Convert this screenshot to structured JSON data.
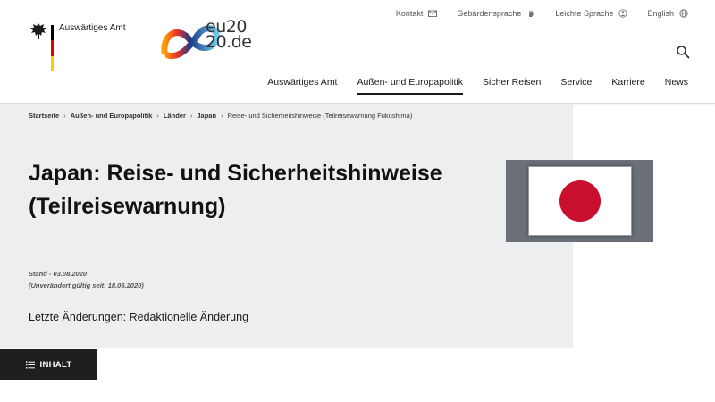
{
  "header": {
    "brand_name": "Auswärtiges Amt",
    "eu_logo_text_line1": "eu20",
    "eu_logo_text_line2": "20.de",
    "meta_nav": [
      {
        "label": "Kontakt",
        "icon": "mail-icon"
      },
      {
        "label": "Gebärdensprache",
        "icon": "sign-language-icon"
      },
      {
        "label": "Leichte Sprache",
        "icon": "easy-language-icon"
      },
      {
        "label": "English",
        "icon": "globe-icon"
      }
    ],
    "main_nav": [
      {
        "label": "Auswärtiges Amt",
        "active": false
      },
      {
        "label": "Außen- und Europapolitik",
        "active": true
      },
      {
        "label": "Sicher Reisen",
        "active": false
      },
      {
        "label": "Service",
        "active": false
      },
      {
        "label": "Karriere",
        "active": false
      },
      {
        "label": "News",
        "active": false
      }
    ]
  },
  "breadcrumb": [
    {
      "label": "Startseite"
    },
    {
      "label": "Außen- und Europapolitik"
    },
    {
      "label": "Länder"
    },
    {
      "label": "Japan"
    },
    {
      "label": "Reise- und Sicherheitshinweise (Teilreisewarnung Fukushima)"
    }
  ],
  "main": {
    "title_line1": "Japan: Reise- und Sicherheitshinweise",
    "title_line2": "(Teilreisewarnung)",
    "stand": "Stand - 03.08.2020",
    "valid_since": "(Unverändert gültig seit: 18.06.2020)",
    "changes": "Letzte Änderungen: Redaktionelle Änderung"
  },
  "inhalt_button": {
    "label": "INHALT"
  },
  "colors": {
    "hero_bg": "#eceef0",
    "flag_red": "#c8102e",
    "button_bg": "#1d1f21",
    "de_black": "#000000",
    "de_red": "#dd0000",
    "de_gold": "#ffcc00"
  }
}
